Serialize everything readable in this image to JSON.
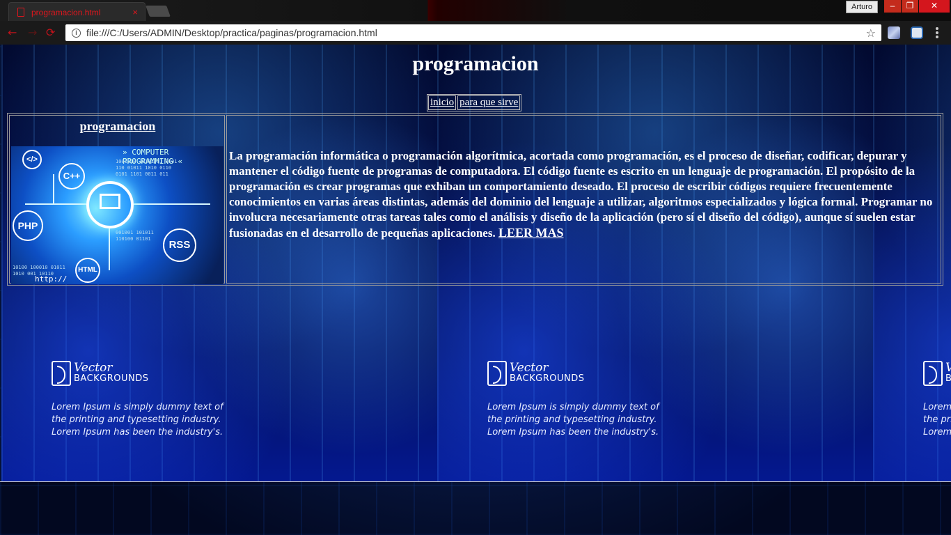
{
  "browser": {
    "tab_title": "programacion.html",
    "tab_close": "×",
    "user": "Arturo",
    "url": "file:///C:/Users/ADMIN/Desktop/practica/paginas/programacion.html",
    "win_min": "–",
    "win_max": "❐",
    "win_close": "✕",
    "back": "←",
    "forward": "→",
    "reload": "⟳",
    "star": "☆"
  },
  "page": {
    "title": "programacion",
    "menu": [
      "inicio",
      "para que sirve"
    ],
    "left_heading": "programacion",
    "paragraph": "La programación informática o programación algorítmica, acortada como programación, es el proceso de diseñar, codificar, depurar y mantener el código fuente de programas de computadora. El código fuente es escrito en un lenguaje de programación. El propósito de la programación es crear programas que exhiban un comportamiento deseado. El proceso de escribir códigos requiere frecuentemente conocimientos en varias áreas distintas, además del dominio del lenguaje a utilizar, algoritmos especializados y lógica formal. Programar no involucra necesariamente otras tareas tales como el análisis y diseño de la aplicación (pero sí el diseño del código), aunque sí suelen estar fusionadas en el desarrollo de pequeñas aplicaciones.",
    "read_more": "LEER MAS"
  },
  "image_labels": {
    "banner": "» COMPUTER PROGRAMMING «",
    "cpp": "C++",
    "php": "PHP",
    "rss": "RSS",
    "html": "HTML",
    "tag": "</>",
    "http": "http://"
  },
  "background": {
    "brand_line1": "Vector",
    "brand_line2": "BACKGROUNDS",
    "lorem": [
      "Lorem Ipsum is simply dummy text of",
      "the printing and typesetting industry.",
      "Lorem Ipsum has been the industry's."
    ]
  }
}
